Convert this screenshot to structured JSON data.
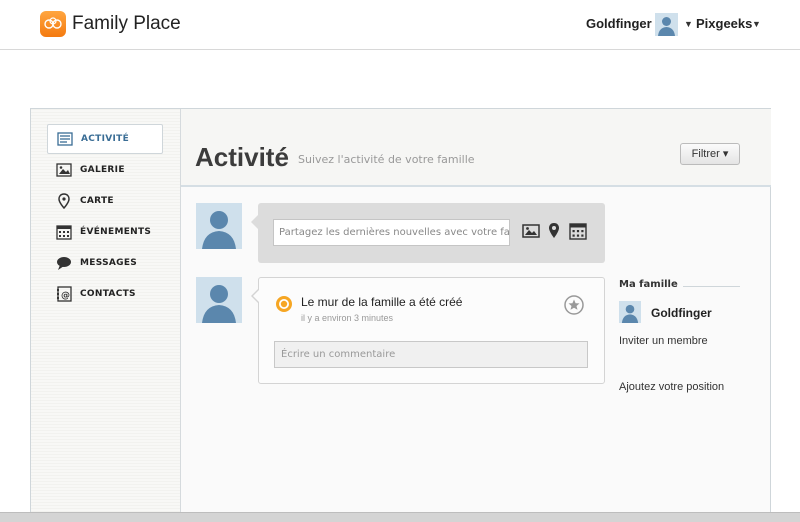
{
  "header": {
    "app_title": "Family Place",
    "user_name": "Goldfinger",
    "site_name": "Pixgeeks"
  },
  "sidebar": {
    "items": [
      {
        "label": "ACTIVITÉ",
        "icon": "activity-icon",
        "active": true
      },
      {
        "label": "GALERIE",
        "icon": "gallery-icon",
        "active": false
      },
      {
        "label": "CARTE",
        "icon": "map-pin-icon",
        "active": false
      },
      {
        "label": "ÉVÉNEMENTS",
        "icon": "calendar-icon",
        "active": false
      },
      {
        "label": "MESSAGES",
        "icon": "speech-bubble-icon",
        "active": false
      },
      {
        "label": "CONTACTS",
        "icon": "contact-card-icon",
        "active": false
      }
    ]
  },
  "main": {
    "title": "Activité",
    "subtitle": "Suivez l'activité de votre famille",
    "filter_label": "Filtrer ▾"
  },
  "composer": {
    "placeholder": "Partagez les dernières nouvelles avec votre famille"
  },
  "post": {
    "title": "Le mur de la famille a été créé",
    "time": "il y a environ 3 minutes",
    "comment_placeholder": "Écrire un commentaire"
  },
  "family": {
    "heading": "Ma famille",
    "member_name": "Goldfinger",
    "invite_label": "Inviter un membre",
    "position_label": "Ajoutez votre position"
  },
  "colors": {
    "brand_orange": "#f47a10",
    "accent_blue": "#3a6d95",
    "avatar_blue": "#5b87ad"
  }
}
